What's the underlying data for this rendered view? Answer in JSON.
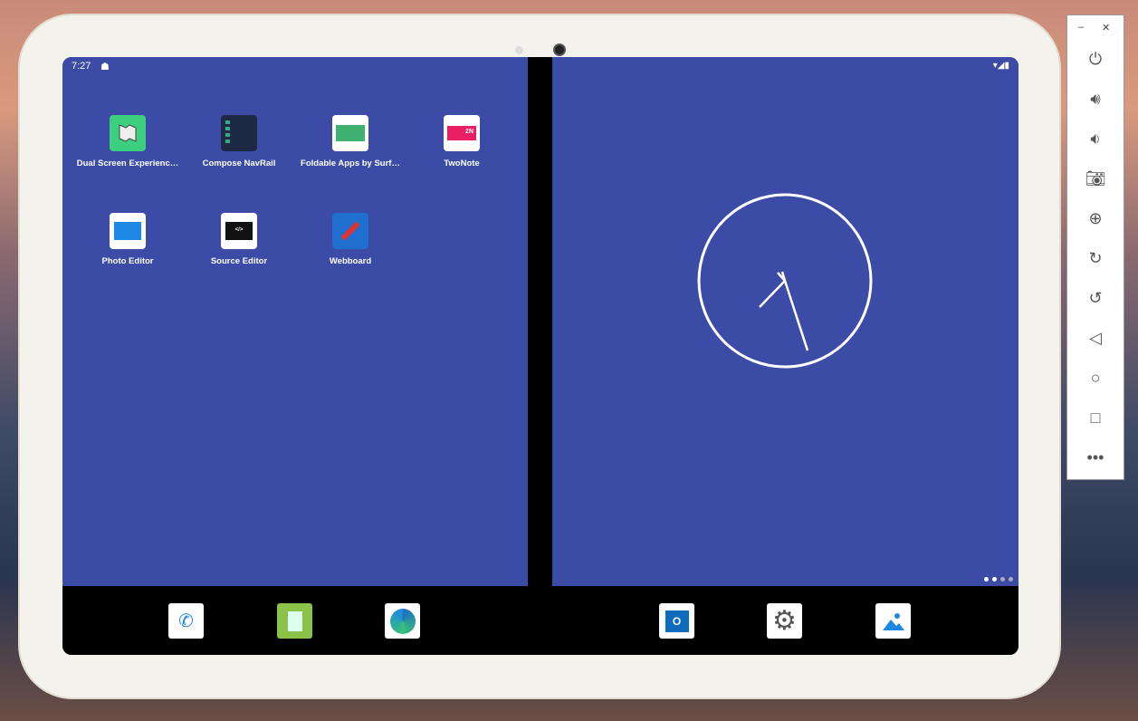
{
  "status": {
    "time": "7:27"
  },
  "apps": [
    {
      "label": "Dual Screen Experienc…",
      "icon": "map-fold-icon"
    },
    {
      "label": "Compose NavRail",
      "icon": "navrail-icon"
    },
    {
      "label": "Foldable Apps by Surf…",
      "icon": "foldable-icon"
    },
    {
      "label": "TwoNote",
      "icon": "twonote-icon",
      "badge": "2N"
    },
    {
      "label": "Photo Editor",
      "icon": "photo-editor-icon"
    },
    {
      "label": "Source Editor",
      "icon": "source-editor-icon",
      "badge": "</>"
    },
    {
      "label": "Webboard",
      "icon": "pencil-icon"
    }
  ],
  "dock": [
    "phone",
    "notes",
    "edge",
    "outlook",
    "settings",
    "photos"
  ],
  "clock": {
    "hour_angle": -135,
    "minute_angle": 160
  },
  "page_indicator": {
    "count": 4,
    "active": 1
  },
  "panel": {
    "minimize": "–",
    "close": "✕"
  },
  "colors": {
    "wallpaper_pane": "#3c4ca6"
  }
}
